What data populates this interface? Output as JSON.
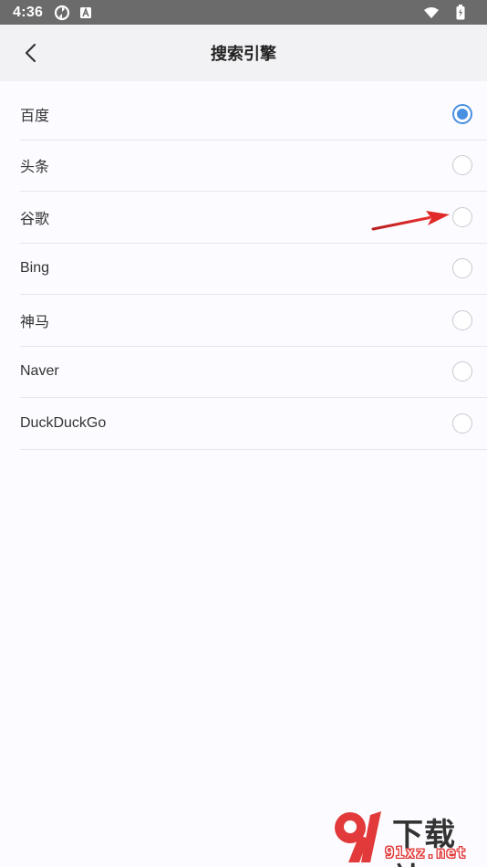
{
  "status_bar": {
    "time": "4:36",
    "icons": [
      "sync-icon",
      "a-badge-icon",
      "wifi-icon",
      "battery-icon"
    ]
  },
  "nav": {
    "title": "搜索引擎",
    "back_icon": "chevron-left-icon"
  },
  "engines": [
    {
      "label": "百度",
      "selected": true
    },
    {
      "label": "头条",
      "selected": false
    },
    {
      "label": "谷歌",
      "selected": false
    },
    {
      "label": "Bing",
      "selected": false
    },
    {
      "label": "神马",
      "selected": false
    },
    {
      "label": "Naver",
      "selected": false
    },
    {
      "label": "DuckDuckGo",
      "selected": false
    }
  ],
  "watermark": {
    "top_text": "下载站",
    "bottom_text": "91xz.net"
  },
  "colors": {
    "accent": "#4a90e2",
    "annotation_arrow": "#d7282a",
    "status_bar": "#6b6b6b",
    "nav_bg": "#f2f2f4"
  }
}
